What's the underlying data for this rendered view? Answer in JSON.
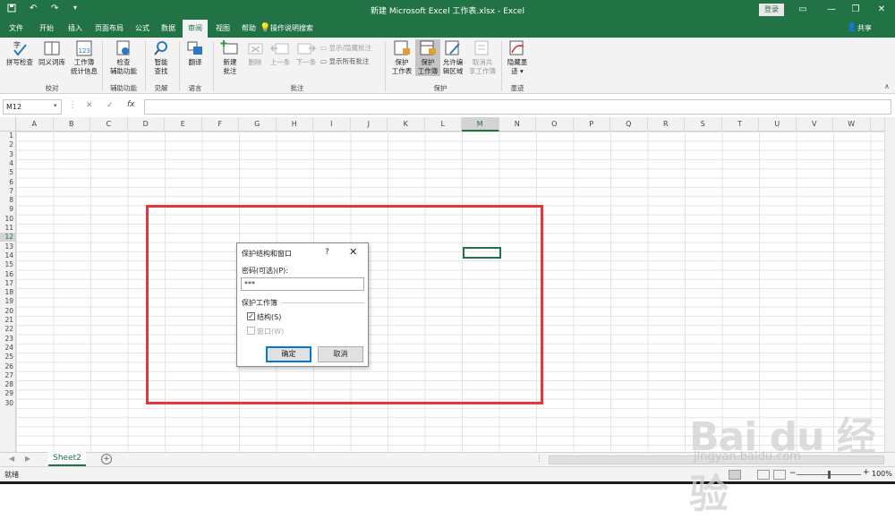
{
  "window": {
    "title": "新建 Microsoft Excel 工作表.xlsx  -  Excel",
    "login_label": "登录",
    "controls": [
      "▭",
      "—",
      "❐",
      "✕"
    ]
  },
  "tabs": [
    "文件",
    "开始",
    "插入",
    "页面布局",
    "公式",
    "数据",
    "审阅",
    "视图",
    "帮助"
  ],
  "active_tab": "审阅",
  "tell_me": "操作说明搜索",
  "share": "共享",
  "ribbon": {
    "spelling": "拼写检查",
    "thesaurus": "同义词库",
    "workbook_stats_1": "工作簿",
    "workbook_stats_2": "统计信息",
    "group_proofing": "校对",
    "check_access_1": "检查",
    "check_access_2": "辅助功能",
    "group_accessibility": "辅助功能",
    "smart_lookup_1": "智能",
    "smart_lookup_2": "查找",
    "group_insights": "见解",
    "translate": "翻译",
    "group_language": "语言",
    "new_comment_1": "新建",
    "new_comment_2": "批注",
    "delete": "删除",
    "previous": "上一条",
    "next": "下一条",
    "show_hide_comment": "显示/隐藏批注",
    "show_all_comments": "显示所有批注",
    "group_comments": "批注",
    "protect_sheet_1": "保护",
    "protect_sheet_2": "工作表",
    "protect_workbook_1": "保护",
    "protect_workbook_2": "工作簿",
    "allow_edit_1": "允许编",
    "allow_edit_2": "辑区域",
    "unshare_1": "取消共",
    "unshare_2": "享工作簿",
    "group_protect": "保护",
    "hide_ink_1": "隐藏墨",
    "hide_ink_2": "迹 ▾",
    "group_ink": "墨迹"
  },
  "formula_bar": {
    "name_box": "M12",
    "cancel": "✕",
    "enter": "✓",
    "fx": "fx",
    "value": ""
  },
  "columns": [
    "A",
    "B",
    "C",
    "D",
    "E",
    "F",
    "G",
    "H",
    "I",
    "J",
    "K",
    "L",
    "M",
    "N",
    "O",
    "P",
    "Q",
    "R",
    "S",
    "T",
    "U",
    "V",
    "W"
  ],
  "selected_column": "M",
  "rows": [
    "1",
    "2",
    "3",
    "4",
    "5",
    "6",
    "7",
    "8",
    "9",
    "10",
    "11",
    "12",
    "13",
    "14",
    "15",
    "16",
    "17",
    "18",
    "19",
    "20",
    "21",
    "22",
    "23",
    "24",
    "25",
    "26",
    "27",
    "28",
    "29",
    "30"
  ],
  "selected_row": "12",
  "dialog": {
    "title": "保护结构和窗口",
    "help": "?",
    "close": "✕",
    "password_label": "密码(可选)(P):",
    "password_value": "***",
    "section_label": "保护工作簿",
    "structure_label": "结构(S)",
    "structure_checked": true,
    "windows_label": "窗口(W)",
    "windows_checked": false,
    "ok": "确定",
    "cancel": "取消"
  },
  "sheet_tab": "Sheet2",
  "status": "就绪",
  "zoom": "100%",
  "watermark": {
    "brand": "Bai du 经验",
    "url": "jingyan.baidu.com"
  },
  "colors": {
    "excel_green": "#217346",
    "highlight_red": "#e8343b"
  }
}
